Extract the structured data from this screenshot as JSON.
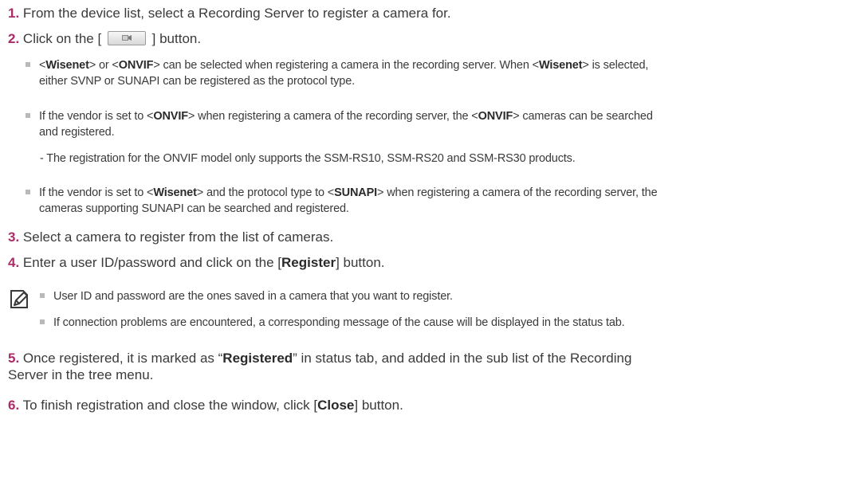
{
  "steps": [
    {
      "num": "1.",
      "text": "From the device list, select a Recording Server to register a camera for."
    },
    {
      "num": "2.",
      "pre": "Click on the [",
      "post": "] button."
    },
    {
      "num": "3.",
      "text": "Select a camera to register from the list of cameras."
    },
    {
      "num": "4.",
      "pre": "Enter a user ID/password and click on the [",
      "bold": "Register",
      "post": "] button."
    },
    {
      "num": "5.",
      "pre": "Once registered, it is marked as “",
      "bold": "Registered",
      "post": "” in status tab, and added in the sub list of the Recording",
      "line2": "Server in the tree menu."
    },
    {
      "num": "6.",
      "pre": "To finish registration and close the window, click [",
      "bold": "Close",
      "post": "] button."
    }
  ],
  "bullets": {
    "b1": {
      "t1": "<",
      "k1": "Wisenet",
      "t2": "> or <",
      "k2": "ONVIF",
      "t3": "> can be selected when registering a camera in the recording server. When <",
      "k3": "Wisenet",
      "t4": "> is selected,",
      "line2": "either SVNP or SUNAPI can be registered as the protocol type."
    },
    "b2": {
      "t1": "If the vendor is set to <",
      "k1": "ONVIF",
      "t2": "> when registering a camera of the recording server, the <",
      "k2": "ONVIF",
      "t3": "> cameras can be searched",
      "line2": "and registered."
    },
    "dash": "-  The registration for the ONVIF model only supports the SSM-RS10, SSM-RS20 and SSM-RS30 products.",
    "b3": {
      "t1": "If the vendor is set to <",
      "k1": "Wisenet",
      "t2": "> and the protocol type to <",
      "k2": "SUNAPI",
      "t3": "> when registering a camera of the recording server, the",
      "line2": "cameras supporting SUNAPI can be searched and registered."
    },
    "n1": "User ID and password are the ones saved in a camera that you want to register.",
    "n2": "If connection problems are encountered, a corresponding message of the cause will be displayed in the status tab."
  },
  "icons": {
    "toolbar_button": "add-camera-icon",
    "note": "note-pencil-icon"
  }
}
